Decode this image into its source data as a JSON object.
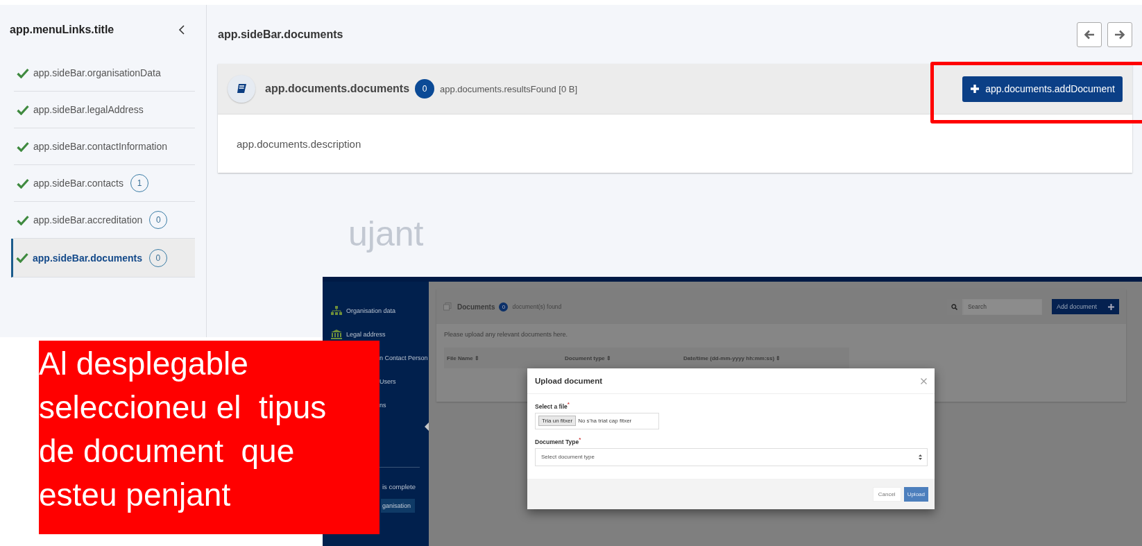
{
  "sidebar": {
    "title": "app.menuLinks.title",
    "items": [
      {
        "label": "app.sideBar.organisationData",
        "complete": true,
        "selected": false
      },
      {
        "label": "app.sideBar.legalAddress",
        "complete": true,
        "selected": false
      },
      {
        "label": "app.sideBar.contactInformation",
        "complete": true,
        "selected": false
      },
      {
        "label": "app.sideBar.contacts",
        "complete": true,
        "selected": false,
        "count": "1"
      },
      {
        "label": "app.sideBar.accreditation",
        "complete": true,
        "selected": false,
        "count": "0"
      },
      {
        "label": "app.sideBar.documents",
        "complete": true,
        "selected": true,
        "count": "0"
      }
    ]
  },
  "page": {
    "title": "app.sideBar.documents"
  },
  "card": {
    "title": "app.documents.documents",
    "count": "0",
    "results": "app.documents.resultsFound [0 B]",
    "add_button": "app.documents.addDocument",
    "description": "app.documents.description"
  },
  "stray_text": "ujant",
  "annotation": {
    "lines": [
      "Al desplegable",
      "seleccioneu el  tipus",
      "de document  que",
      "esteu penjant"
    ]
  },
  "inset": {
    "sidebar_items": [
      {
        "label": "Organisation data",
        "kind": "org"
      },
      {
        "label": "Legal address",
        "kind": "bank"
      },
      {
        "label": "n Contact Person",
        "kind": "plain"
      },
      {
        "label": "Users",
        "kind": "plain"
      },
      {
        "label": "ns",
        "kind": "plain"
      }
    ],
    "status_text": "is complete",
    "status_button": "ganisation",
    "panel": {
      "title": "Documents",
      "count": "0",
      "found": "document(s) found",
      "search_placeholder": "Search",
      "add_button": "Add document",
      "description": "Please upload any relevant documents here.",
      "columns": [
        "File Name ⇕",
        "Document type ⇕",
        "Date/time (dd-mm-yyyy hh:mm:ss) ⇕"
      ]
    },
    "modal": {
      "title": "Upload document",
      "file_label": "Select a file",
      "required_mark": "*",
      "file_button": "Tria un fitxer",
      "file_status": "No s'ha triat cap fitxer",
      "type_label": "Document Type",
      "type_placeholder": "Select document type",
      "cancel": "Cancel",
      "upload": "Upload"
    }
  }
}
